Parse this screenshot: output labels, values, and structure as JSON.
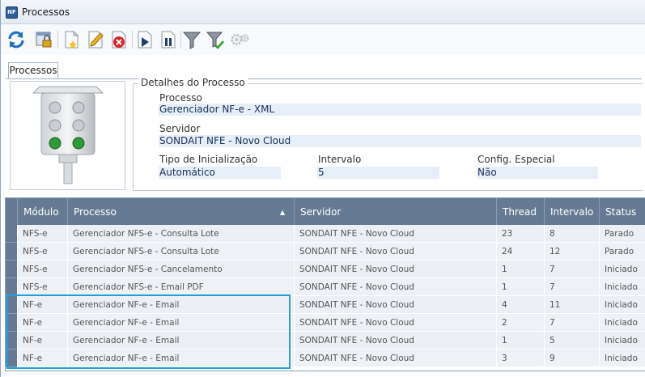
{
  "window": {
    "title": "Processos",
    "app_icon_text": "NF"
  },
  "toolbar": {
    "buttons": [
      {
        "name": "refresh-icon"
      },
      {
        "name": "lock-config-icon"
      },
      {
        "name": "new-document-icon"
      },
      {
        "name": "edit-pencil-icon"
      },
      {
        "name": "delete-icon"
      },
      {
        "name": "play-icon"
      },
      {
        "name": "pause-icon"
      },
      {
        "name": "filter-icon"
      },
      {
        "name": "filter-apply-icon"
      },
      {
        "name": "settings-gear-icon"
      }
    ]
  },
  "tabs": [
    {
      "label": "Processos"
    }
  ],
  "details": {
    "legend": "Detalhes do Processo",
    "processo_label": "Processo",
    "processo_value": "Gerenciador NF-e - XML",
    "servidor_label": "Servidor",
    "servidor_value": "SONDAIT NFE - Novo Cloud",
    "tipo_label": "Tipo de Inicialização",
    "tipo_value": "Automático",
    "intervalo_label": "Intervalo",
    "intervalo_value": "5",
    "config_label": "Config. Especial",
    "config_value": "Não"
  },
  "grid": {
    "columns": [
      "Módulo",
      "Processo",
      "Servidor",
      "Thread",
      "Intervalo",
      "Status"
    ],
    "sort_indicator": "▲",
    "rows": [
      [
        "NFS-e",
        "Gerenciador NFS-e - Consulta Lote",
        "SONDAIT NFE - Novo Cloud",
        "23",
        "8",
        "Parado"
      ],
      [
        "NFS-e",
        "Gerenciador NFS-e - Consulta Lote",
        "SONDAIT NFE - Novo Cloud",
        "24",
        "12",
        "Parado"
      ],
      [
        "NFS-e",
        "Gerenciador NFS-e - Cancelamento",
        "SONDAIT NFE - Novo Cloud",
        "1",
        "7",
        "Iniciado"
      ],
      [
        "NFS-e",
        "Gerenciador NFS-e - Email PDF",
        "SONDAIT NFE - Novo Cloud",
        "1",
        "7",
        "Iniciado"
      ],
      [
        "NF-e",
        "Gerenciador NF-e - Email",
        "SONDAIT NFE - Novo Cloud",
        "4",
        "11",
        "Iniciado"
      ],
      [
        "NF-e",
        "Gerenciador NF-e - Email",
        "SONDAIT NFE - Novo Cloud",
        "2",
        "7",
        "Iniciado"
      ],
      [
        "NF-e",
        "Gerenciador NF-e - Email",
        "SONDAIT NFE - Novo Cloud",
        "1",
        "5",
        "Iniciado"
      ],
      [
        "NF-e",
        "Gerenciador NF-e - Email",
        "SONDAIT NFE - Novo Cloud",
        "3",
        "9",
        "Iniciado"
      ]
    ]
  },
  "colors": {
    "header_bg": "#657a94",
    "highlight": "#1ea1d8",
    "value_bg": "#e6eef8"
  }
}
